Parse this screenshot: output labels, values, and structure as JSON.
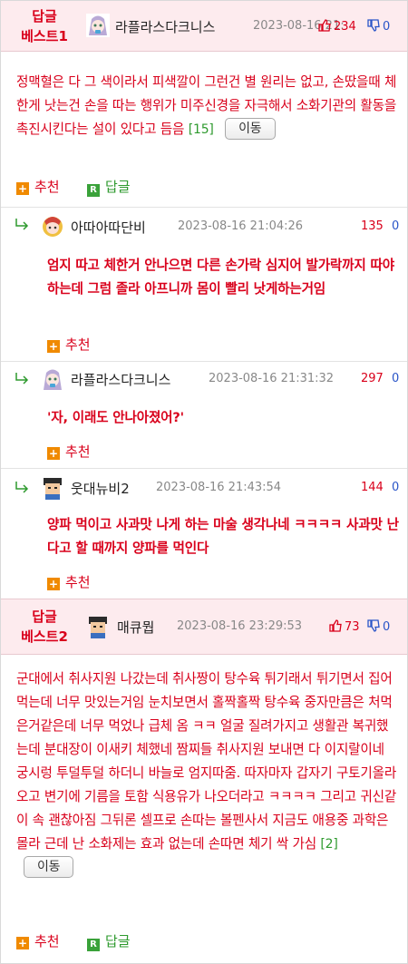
{
  "best1": {
    "label_line1": "답글",
    "label_line2": "베스트1",
    "nick": "라플라스다크니스",
    "date": "2023-08-16 21:",
    "up": "234",
    "down": "0",
    "body": "정맥혈은 다 그 색이라서 피색깔이 그런건 별 원리는 없고, 손땄을때 체한게 낫는건 손을 따는 행위가 미주신경을 자극해서 소화기관의 활동을 촉진시킨다는 설이 있다고 듬음",
    "count": "[15]",
    "move": "이동",
    "recommend": "추천",
    "reply": "답글"
  },
  "replies": [
    {
      "nick": "아따아따단비",
      "date": "2023-08-16 21:04:26",
      "score": "135",
      "body": "엄지 따고 체한거 안나으면 다른 손가락 심지어 발가락까지 따야하는데 그럼 졸라 아프니까 몸이 빨리 낫게하는거임",
      "recommend": "추천"
    },
    {
      "nick": "라플라스다크니스",
      "date": "2023-08-16 21:31:32",
      "score": "297",
      "body": "'자, 이래도 안나아졌어?'",
      "recommend": "추천"
    },
    {
      "nick": "웃대뉴비2",
      "date": "2023-08-16 21:43:54",
      "score": "144",
      "body": "양파 먹이고 사과맛 나게 하는 마술 생각나네 ㅋㅋㅋㅋ 사과맛 난다고 할 때까지 양파를 먹인다",
      "recommend": "추천"
    }
  ],
  "best2": {
    "label_line1": "답글",
    "label_line2": "베스트2",
    "nick": "매큐뭡",
    "date": "2023-08-16 23:29:53",
    "up": "73",
    "down": "0",
    "body": "군대에서 취사지원 나갔는데 취사짱이 탕수육 튀기래서 튀기면서 집어먹는데 너무 맛있는거임 눈치보면서 홀짝홀짝 탕수육 중자만큼은 처먹은거같은데 너무 먹었나 급체 옴 ㅋㅋ 얼굴 질려가지고 생활관 복귀했는데 분대장이 이새키 체했네 짬찌들 취사지원 보내면 다 이지랄이네 궁시렁 투덜투덜 하더니 바늘로 엄지따줌. 따자마자 갑자기 구토기올라오고 변기에 기름을 토함 식용유가 나오더라고 ㅋㅋㅋㅋ 그리고 귀신같이 속 괜찮아짐 그뒤론 셀프로 손따는 볼펜사서 지금도 애용중 과학은 몰라 근데 난 소화제는 효과 없는데 손따면 체기 싹 가심",
    "count": "[2]",
    "move": "이동",
    "recommend": "추천",
    "reply": "답글"
  },
  "colors": {
    "accent_red": "#d9001b",
    "best_bg": "#fdebee",
    "green": "#2e9a2e",
    "down_blue": "#2a55c8"
  },
  "icons": [
    "thumbs-up-icon",
    "thumbs-down-icon",
    "plus-icon",
    "reply-r-icon",
    "reply-arrow-icon",
    "avatar"
  ]
}
